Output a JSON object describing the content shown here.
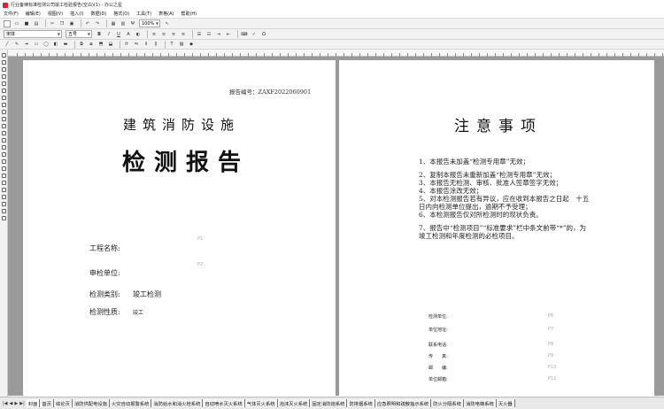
{
  "window": {
    "title": "行业备律标准检测公司竣工检验报告(空白)(1) - 办公之星"
  },
  "menu": [
    "文件(F)",
    "编辑(E)",
    "视图(V)",
    "插入(I)",
    "数据(D)",
    "格式(O)",
    "工具(T)",
    "表格(A)",
    "帮助(H)"
  ],
  "toolbar": {
    "zoom": "100%",
    "font_name": "宋体",
    "font_size": "五号",
    "bold": "B",
    "italic": "I",
    "underline": "U"
  },
  "left_page": {
    "report_no": "报告编号：ZAXF2022060901",
    "title_line1": "建筑消防设施",
    "title_line2": "检测报告",
    "fields": [
      {
        "label": "工程名称:",
        "value": "",
        "placeholder": "P1"
      },
      {
        "label": "申检单位:",
        "value": "",
        "placeholder": "P2"
      },
      {
        "label": "检测类别:",
        "value": "竣工检测",
        "placeholder": ""
      },
      {
        "label": "检测性质:",
        "value": "竣工",
        "placeholder": ""
      }
    ]
  },
  "right_page": {
    "title": "注意事项",
    "notices": [
      "1、本报告未加盖“检测专用章”无效；",
      "2、复制本报告未重新加盖“检测专用章”无效；",
      "3、本报告无检测、审核、批准人签章签字无效；",
      "4、本报告涂改无效；",
      "5、对本检测报告若有异议，应在收到本报告之日起　十五日内向检测单位提出，逾期不予受理；",
      "6、本检测报告仅对所检测时的现状负责。",
      "7、报告中“检测项目”“标准要求”栏中条文前带“*”的，为竣工检测和年度检测的必检项目。"
    ],
    "contacts": [
      {
        "label": "检测单位:",
        "placeholder": "P6"
      },
      {
        "label": "单位地址:",
        "placeholder": "P7"
      },
      {
        "label": "联系电话:",
        "placeholder": "P8"
      },
      {
        "label": "传　　真:",
        "placeholder": "P9"
      },
      {
        "label": "邮　　编:",
        "placeholder": "P10"
      },
      {
        "label": "单位邮箱:",
        "placeholder": "P11"
      }
    ]
  },
  "tabs": [
    "封面",
    "首页",
    "综论页",
    "消防供配电设施",
    "火灾自动报警系统",
    "消防给水和消火栓系统",
    "自动喷水灭火系统",
    "气体灭火系统",
    "泡沫灭火系统",
    "固定消防炮系统",
    "防排烟系统",
    "应急照明和疏散指示系统",
    "防火分隔系统",
    "消防电梯系统",
    "灭火器"
  ]
}
